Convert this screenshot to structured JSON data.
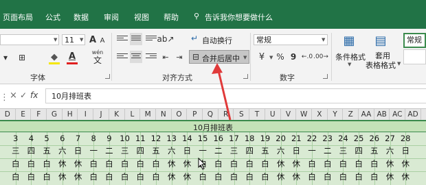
{
  "tabs": [
    "页面布局",
    "公式",
    "数据",
    "审阅",
    "视图",
    "帮助"
  ],
  "tell_me": "告诉我你想要做什么",
  "font_group": {
    "size": "11",
    "label": "字体",
    "color_a": "A",
    "wen": "wén"
  },
  "alignment_group": {
    "wrap_text": "自动换行",
    "merge_center": "合并后居中",
    "label": "对齐方式"
  },
  "number_group": {
    "format": "常规",
    "percent": "%",
    "comma": "9",
    "label": "数字"
  },
  "styles_group": {
    "conditional_format": "条件格式",
    "table_format_line1": "套用",
    "table_format_line2": "表格格式",
    "cell_style": "常规"
  },
  "formula_bar": {
    "cancel": "×",
    "enter": "✓",
    "fx": "fx",
    "content": "10月排班表"
  },
  "column_headers": [
    "D",
    "E",
    "F",
    "G",
    "H",
    "I",
    "J",
    "K",
    "L",
    "M",
    "N",
    "O",
    "P",
    "Q",
    "R",
    "S",
    "T",
    "U",
    "V",
    "W",
    "X",
    "Y",
    "Z",
    "AA",
    "AB",
    "AC",
    "AD"
  ],
  "sheet": {
    "title": "10月排班表",
    "days": [
      "3",
      "4",
      "5",
      "6",
      "7",
      "8",
      "9",
      "10",
      "11",
      "12",
      "13",
      "14",
      "15",
      "16",
      "17",
      "18",
      "19",
      "20",
      "21",
      "22",
      "23",
      "24",
      "25",
      "26",
      "27",
      "28"
    ],
    "weekdays": [
      "三",
      "四",
      "五",
      "六",
      "日",
      "一",
      "二",
      "三",
      "四",
      "五",
      "六",
      "日",
      "一",
      "二",
      "三",
      "四",
      "五",
      "六",
      "日",
      "一",
      "二",
      "三",
      "四",
      "五",
      "六",
      "日"
    ],
    "shift_a": [
      "白",
      "白",
      "白",
      "休",
      "休",
      "白",
      "白",
      "白",
      "白",
      "白",
      "休",
      "休",
      "白",
      "白",
      "白",
      "白",
      "白",
      "休",
      "休",
      "白",
      "白",
      "白",
      "白",
      "白",
      "休",
      "休"
    ],
    "shift_b": [
      "白",
      "白",
      "白",
      "休",
      "休",
      "白",
      "白",
      "白",
      "白",
      "白",
      "休",
      "休",
      "白",
      "白",
      "白",
      "白",
      "白",
      "休",
      "休",
      "白",
      "白",
      "白",
      "白",
      "白",
      "休",
      "休"
    ]
  },
  "colors": {
    "ribbon_green": "#217346",
    "sheet_fill": "#d9ead3",
    "arrow_red": "#e03a3a"
  }
}
